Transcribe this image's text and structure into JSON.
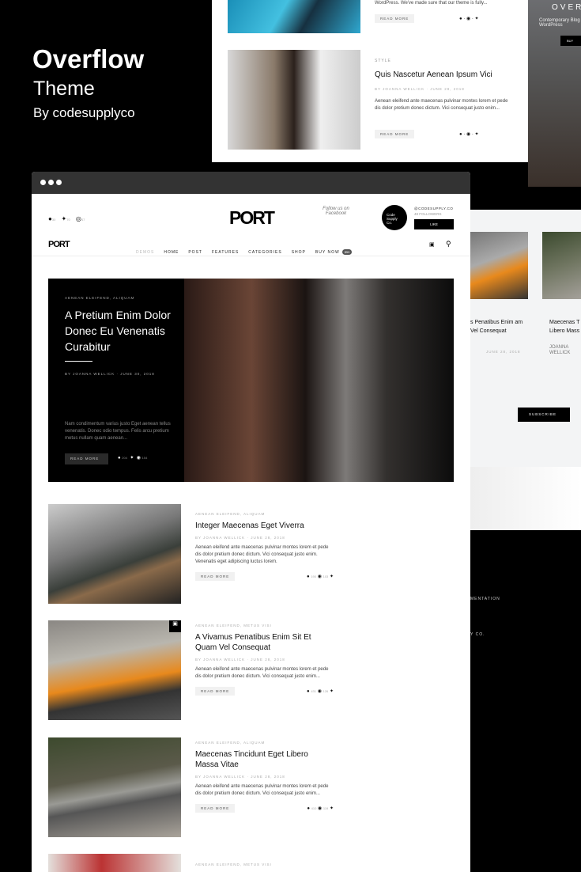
{
  "brand": {
    "title": "Overflow",
    "subtitle": "Theme",
    "by": "By codesupplyco"
  },
  "bg_preview": {
    "excerpt_top": "WordPress. We've made sure that our theme is fully...",
    "read_more": "READ MORE",
    "post": {
      "category": "STYLE",
      "title": "Quis Nascetur Aenean Ipsum Vici",
      "author": "BY JOANNA WELLICK",
      "date": "JUNE 28, 2018",
      "excerpt": "Aenean eleifend ante maecenas pulvinar montes lorem et pede dis dolor pretium donec dictum. Vici consequat justo enim..."
    },
    "side_banner": {
      "title": "OVER",
      "text": "Contemporary Blog WordPress",
      "button": "BUY"
    },
    "cards": [
      {
        "title": "s Penatibus Enim am Vel Consequat",
        "date": "JUNE 28, 2018"
      },
      {
        "title": "Maecenas T Libero Mass",
        "author": "JOANNA WELLICK"
      }
    ],
    "subscribe": "SUBSCRIBE",
    "footer": [
      "MENTATION",
      "Y CO."
    ]
  },
  "site": {
    "logo": "PORT",
    "social_counts": {
      "facebook": "30",
      "twitter": "70",
      "instagram": "47"
    },
    "follow_text": "Follow us on Facebook",
    "fb_badge": "Code Supply Co.",
    "fb_handle": "@CODESUPPLY.CO",
    "fb_followers": "48 FOLLOWERS",
    "like": "LIKE",
    "nav": [
      {
        "label": "DEMOS"
      },
      {
        "label": "HOME"
      },
      {
        "label": "POST"
      },
      {
        "label": "FEATURES"
      },
      {
        "label": "CATEGORIES"
      },
      {
        "label": "SHOP"
      },
      {
        "label": "BUY NOW"
      }
    ],
    "buy_badge": "$59"
  },
  "hero": {
    "category": "AENEAN ELEIFEND, ALIQUAM",
    "title": "A Pretium Enim Dolor Donec Eu Venenatis Curabitur",
    "author": "BY JOANNA WELLICK",
    "date": "JUNE 30, 2018",
    "excerpt": "Nam condimentum varius justo Eget aenean tellus venenatis. Donec odio tempus. Felis arcu pretium metus nullam quam aenean...",
    "read_more": "READ MORE",
    "fb": "204",
    "pin": "154"
  },
  "posts": [
    {
      "category": "AENEAN ELEIFEND, ALIQUAM",
      "title": "Integer Maecenas Eget Viverra",
      "author": "BY JOANNA WELLICK",
      "date": "JUNE 28, 2018",
      "excerpt": "Aenean eleifend ante maecenas pulvinar montes lorem et pede dis dolor pretium donec dictum. Vici consequat justo enim. Venenatis eget adipiscing luctus lorem.",
      "read_more": "READ MORE",
      "fb": "190",
      "pin": "103"
    },
    {
      "category": "AENEAN ELEIFEND, METUS VISI",
      "title": "A Vivamus Penatibus Enim Sit Et Quam Vel Consequat",
      "author": "BY JOANNA WELLICK",
      "date": "JUNE 28, 2018",
      "excerpt": "Aenean eleifend ante maecenas pulvinar montes lorem et pede dis dolor pretium donec dictum. Vici consequat justo enim...",
      "read_more": "READ MORE",
      "fb": "431",
      "pin": "126"
    },
    {
      "category": "AENEAN ELEIFEND, ALIQUAM",
      "title": "Maecenas Tincidunt Eget Libero Massa Vitae",
      "author": "BY JOANNA WELLICK",
      "date": "JUNE 28, 2018",
      "excerpt": "Aenean eleifend ante maecenas pulvinar montes lorem et pede dis dolor pretium donec dictum. Vici consequat justo enim...",
      "read_more": "READ MORE",
      "fb": "410",
      "pin": "119"
    },
    {
      "category": "AENEAN ELEIFEND, METUS VISI"
    }
  ]
}
